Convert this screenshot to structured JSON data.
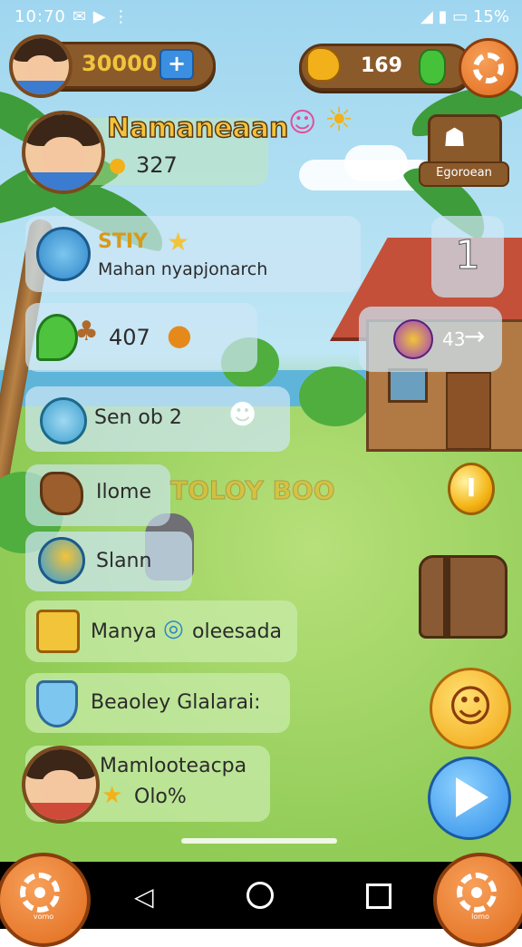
{
  "status_bar": {
    "time": "10:70",
    "battery": "15%"
  },
  "top_bar": {
    "coins": "30000",
    "add_label": "+",
    "gems": "169"
  },
  "profile": {
    "name": "Namaneaan",
    "score": "327"
  },
  "top_right_badge": {
    "label": "Egoroean"
  },
  "panels": {
    "quest": {
      "title": "STIY",
      "subtitle": "Mahan nyapjonarch"
    },
    "quest_count": "1",
    "plant": {
      "value": "407"
    },
    "transfer": {
      "value": "43"
    },
    "seed": {
      "label": "Sen ob 2"
    },
    "home": {
      "label": "Ilome",
      "sign": "TOLOY BOO"
    },
    "bird": {
      "label": "Slann"
    },
    "task1": {
      "label": "Manya",
      "suffix": "oleesada"
    },
    "task2": {
      "label": "Beaoley Glalarai:"
    },
    "friend": {
      "name": "Mamlooteacpa",
      "value": "Olo%"
    }
  },
  "coin_button": {
    "label": "I"
  },
  "corner_left": {
    "label": "vomo"
  },
  "corner_right": {
    "label": "lomo"
  },
  "colors": {
    "accent": "#e06b1c",
    "wood": "#8b5a2b",
    "title_gold": "#f2c43a",
    "play_blue": "#2e8ee8"
  }
}
